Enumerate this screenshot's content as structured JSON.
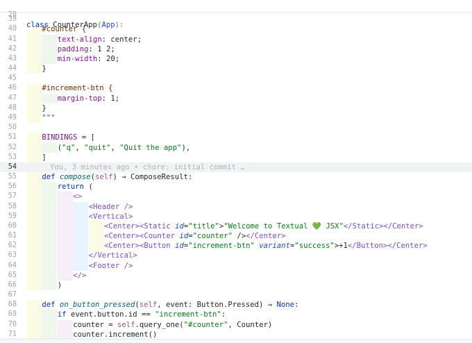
{
  "sticky": {
    "line_number": "20",
    "code": "class CounterApp(App):"
  },
  "current_line": "54",
  "blame": "You, 3 minutes ago • chore: initial commit …",
  "lines": [
    {
      "n": "39",
      "text": ""
    },
    {
      "n": "40",
      "text": "#counter {"
    },
    {
      "n": "41",
      "text": "text-align: center;"
    },
    {
      "n": "42",
      "text": "padding: 1 2;"
    },
    {
      "n": "43",
      "text": "min-width: 20;"
    },
    {
      "n": "44",
      "text": "}"
    },
    {
      "n": "45",
      "text": ""
    },
    {
      "n": "46",
      "text": "#increment-btn {"
    },
    {
      "n": "47",
      "text": "margin-top: 1;"
    },
    {
      "n": "48",
      "text": "}"
    },
    {
      "n": "49",
      "text": "\"\"\""
    },
    {
      "n": "50",
      "text": ""
    },
    {
      "n": "51",
      "text": "BINDINGS = ["
    },
    {
      "n": "52",
      "text": "(\"q\", \"quit\", \"Quit the app\"),"
    },
    {
      "n": "53",
      "text": "]"
    },
    {
      "n": "54",
      "text": ""
    },
    {
      "n": "55",
      "text": "def compose(self) → ComposeResult:"
    },
    {
      "n": "56",
      "text": "return ("
    },
    {
      "n": "57",
      "text": "<>"
    },
    {
      "n": "58",
      "text": "<Header />"
    },
    {
      "n": "59",
      "text": "<Vertical>"
    },
    {
      "n": "60",
      "text": "<Center><Static id=\"title\">\"Welcome to Textual 💚 JSX\"</Static></Center>"
    },
    {
      "n": "61",
      "text": "<Center><Counter id=\"counter\" /></Center>"
    },
    {
      "n": "62",
      "text": "<Center><Button id=\"increment-btn\" variant=\"success\">+1</Button></Center>"
    },
    {
      "n": "63",
      "text": "</Vertical>"
    },
    {
      "n": "64",
      "text": "<Footer />"
    },
    {
      "n": "65",
      "text": "</>"
    },
    {
      "n": "66",
      "text": ")"
    },
    {
      "n": "67",
      "text": ""
    },
    {
      "n": "68",
      "text": "def on_button_pressed(self, event: Button.Pressed) → None:"
    },
    {
      "n": "69",
      "text": "if event.button.id == \"increment-btn\":"
    },
    {
      "n": "70",
      "text": "counter = self.query_one(\"#counter\", Counter)"
    },
    {
      "n": "71",
      "text": "counter.increment()"
    }
  ],
  "colors": {
    "keyword": "#0033b3",
    "function": "#00627a",
    "string": "#067d17",
    "tag": "#7a4cbf",
    "attribute": "#174ad4",
    "indent_guide_1": "#fbfbe6",
    "indent_guide_2": "#eef6ee",
    "indent_guide_3": "#f6eef7",
    "indent_guide_4": "#e9f3fb"
  }
}
